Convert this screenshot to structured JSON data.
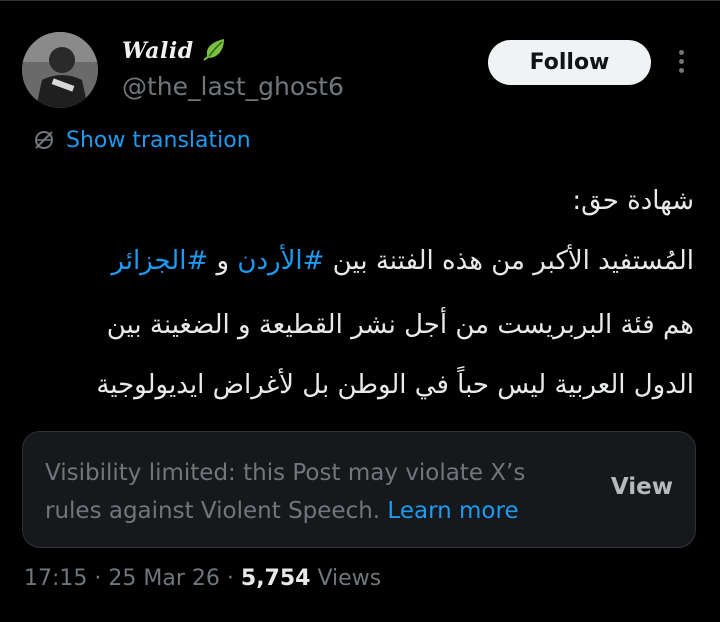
{
  "author": {
    "display_name": "Walid",
    "handle": "@the_last_ghost6",
    "avatar_icon": "profile-photo",
    "badge_icon": "leaf-icon"
  },
  "actions": {
    "follow_label": "Follow",
    "more_icon": "more-vertical-icon"
  },
  "translation": {
    "label": "Show translation",
    "icon": "translate-icon"
  },
  "post": {
    "line1": "شهادة حق:",
    "line2_prefix": "المُستفيد الأكبر من هذه الفتنة بين ",
    "hashtag1": "#الأردن",
    "line2_mid": " و ",
    "hashtag2": "#الجزائر",
    "line3": "هم فئة البربريست من أجل نشر القطيعة و الضغينة بين",
    "line4": "الدول العربية ليس حباً في الوطن بل لأغراض ايديولوجية"
  },
  "notice": {
    "text": "Visibility limited: this Post may violate X’s rules against Violent Speech.",
    "learn_more": "Learn more",
    "view_label": "View"
  },
  "meta": {
    "time": "17:15",
    "separator": "·",
    "date": "25 Mar 26",
    "views_count": "5,754",
    "views_label": "Views"
  },
  "colors": {
    "background": "#000000",
    "accent": "#1d9bf0",
    "muted": "#71767b",
    "text": "#e7e9ea",
    "button_bg": "#eff3f4"
  }
}
